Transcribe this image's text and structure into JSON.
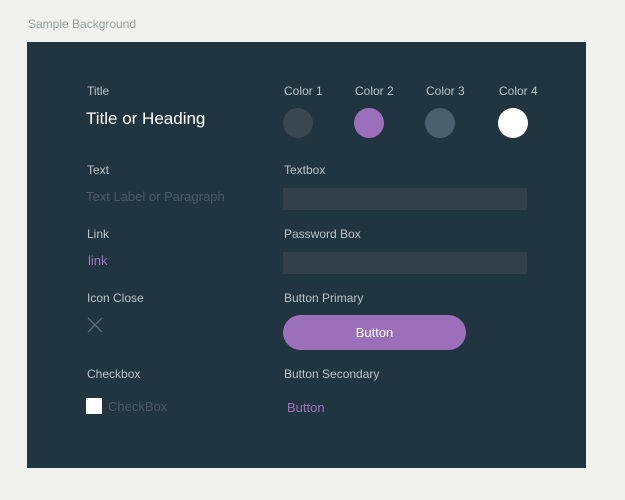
{
  "background_caption": "Sample Background",
  "left": {
    "title_label": "Title",
    "title_value": "Title or Heading",
    "text_label": "Text",
    "text_value": "Text Label or Paragraph",
    "link_label": "Link",
    "link_value": "link",
    "icon_close_label": "Icon Close",
    "checkbox_label": "Checkbox",
    "checkbox_value": "CheckBox",
    "checkbox_checked": false
  },
  "right": {
    "colors": [
      {
        "label": "Color 1",
        "hex": "#3a4750"
      },
      {
        "label": "Color 2",
        "hex": "#9b6fba"
      },
      {
        "label": "Color 3",
        "hex": "#4c5f6c"
      },
      {
        "label": "Color 4",
        "hex": "#ffffff"
      }
    ],
    "textbox_label": "Textbox",
    "textbox_value": "",
    "password_label": "Password Box",
    "password_value": "",
    "button_primary_label": "Button Primary",
    "button_primary_text": "Button",
    "button_secondary_label": "Button Secondary",
    "button_secondary_text": "Button"
  },
  "theme": {
    "panel_bg": "#213540",
    "accent": "#9b6fba",
    "input_bg": "#314049"
  },
  "icons": {
    "close": "close-icon"
  }
}
